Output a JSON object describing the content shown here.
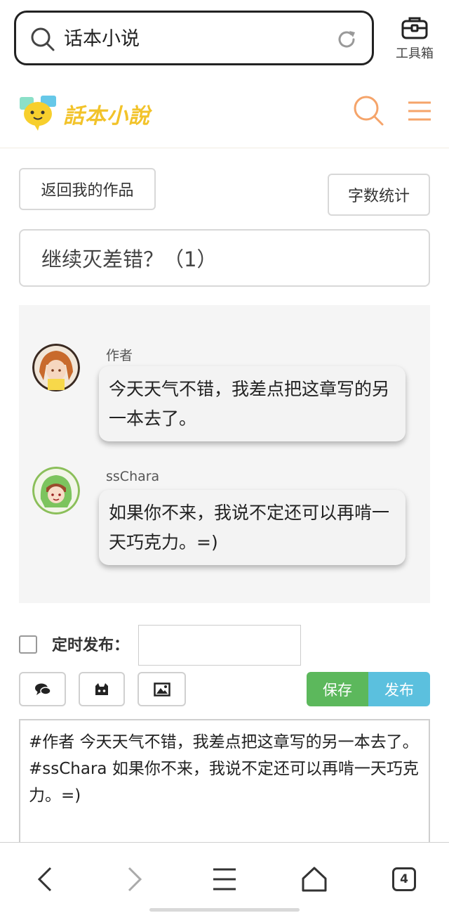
{
  "browser": {
    "url_text": "话本小说",
    "toolbox_label": "工具箱",
    "tab_count": "4"
  },
  "site": {
    "logo_text": "話本小說"
  },
  "editor": {
    "back_button": "返回我的作品",
    "word_count_button": "字数统计",
    "chapter_title": "继续灭差错？（1）",
    "schedule_label": "定时发布：",
    "schedule_checked": false,
    "schedule_value": "",
    "save_button": "保存",
    "publish_button": "发布",
    "content": "#作者 今天天气不错，我差点把这章写的另一本去了。\n#ssChara 如果你不来，我说不定还可以再啃一天巧克力。=)",
    "colors": {
      "save": "#5cb85c",
      "publish": "#5bc0de",
      "accent_orange": "#f5a46a",
      "logo_yellow": "#f2c32a"
    }
  },
  "chat": {
    "messages": [
      {
        "speaker": "作者",
        "text": "今天天气不错，我差点把这章写的另一本去了。"
      },
      {
        "speaker": "ssChara",
        "text": "如果你不来，我说不定还可以再啃一天巧克力。=)"
      }
    ]
  }
}
